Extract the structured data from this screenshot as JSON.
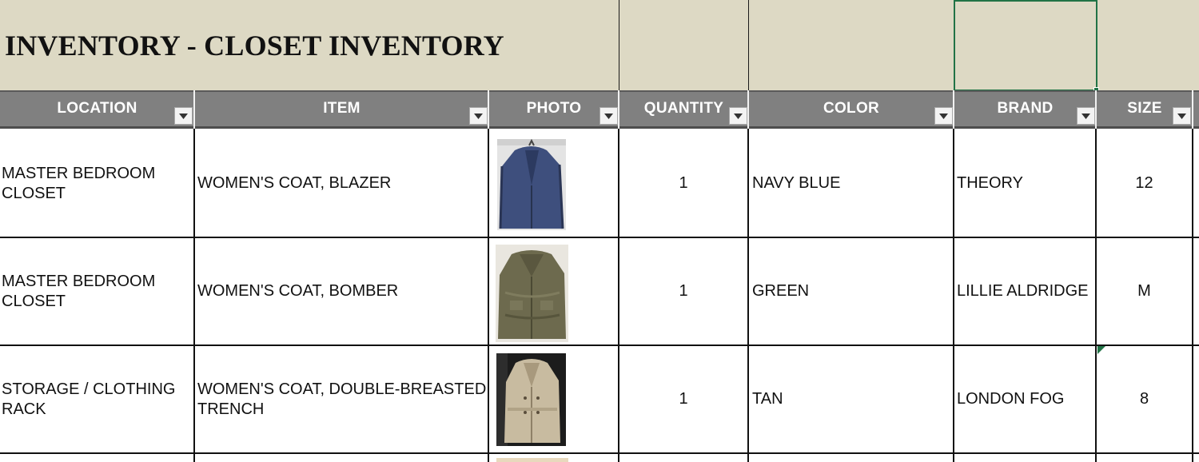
{
  "sheet": {
    "title": "INVENTORY - CLOSET INVENTORY",
    "columns": [
      "LOCATION",
      "ITEM",
      "PHOTO",
      "QUANTITY",
      "COLOR",
      "BRAND",
      "SIZE"
    ],
    "rows": [
      {
        "location": "MASTER BEDROOM CLOSET",
        "item": "WOMEN'S COAT, BLAZER",
        "photo_icon": "navy-blazer-photo",
        "quantity": "1",
        "color": "NAVY BLUE",
        "brand": "THEORY",
        "size": "12"
      },
      {
        "location": "MASTER BEDROOM CLOSET",
        "item": "WOMEN'S COAT, BOMBER",
        "photo_icon": "green-bomber-photo",
        "quantity": "1",
        "color": "GREEN",
        "brand": "LILLIE ALDRIDGE",
        "size": "M"
      },
      {
        "location": "STORAGE / CLOTHING RACK",
        "item": "WOMEN'S COAT, DOUBLE-BREASTED TRENCH",
        "photo_icon": "tan-trench-photo",
        "quantity": "1",
        "color": "TAN",
        "brand": "LONDON FOG",
        "size": "8"
      }
    ]
  },
  "colors": {
    "title_band": "#ddd9c4",
    "header_bg": "#808080",
    "selection": "#217346"
  }
}
